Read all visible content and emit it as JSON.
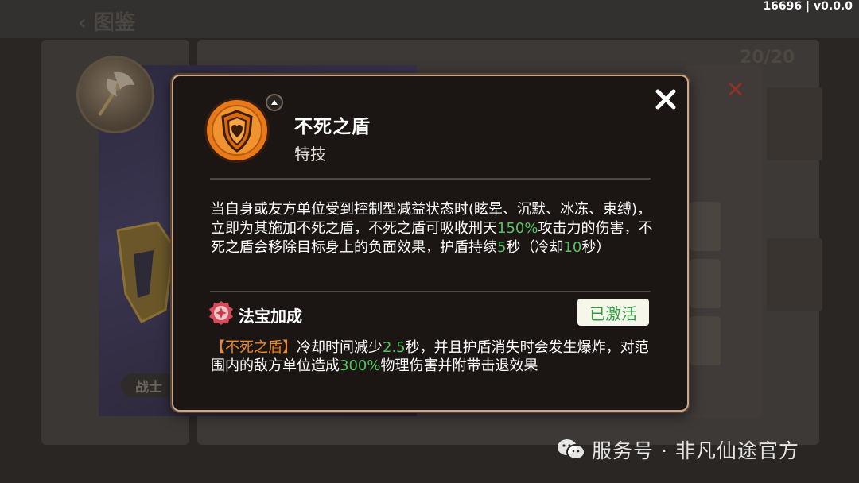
{
  "background": {
    "nav_title": "图鉴",
    "version": "16696 | v0.0.0",
    "class_tag": "战士",
    "counter": "20/20"
  },
  "popup": {
    "skill_name": "不死之盾",
    "skill_type": "特技",
    "description": {
      "part1": "当自身或友方单位受到控制型减益状态时(眩晕、沉默、冰冻、束缚)，立即为其施加不死之盾，不死之盾可吸收刑天",
      "value1": "150%",
      "part2": "攻击力的伤害，不死之盾会移除目标身上的负面效果，护盾持续",
      "value2": "5",
      "part3": "秒（冷却",
      "value3": "10",
      "part4": "秒）"
    },
    "treasure": {
      "title": "法宝加成",
      "status": "已激活",
      "skill_ref": "【不死之盾】",
      "part1": "冷却时间减少",
      "value1": "2.5",
      "part2": "秒，并且护盾消失时会发生爆炸，对范围内的敌方单位造成",
      "value2": "300%",
      "part3": "物理伤害并附带击退效果"
    },
    "colors": {
      "highlight_value": "#55c25e",
      "highlight_ref": "#f08a24",
      "icon_orange": "#e87a1c",
      "status_text": "#2f9b43"
    }
  },
  "watermark": {
    "text": "服务号 · 非凡仙途官方",
    "icon": "wechat-icon"
  }
}
